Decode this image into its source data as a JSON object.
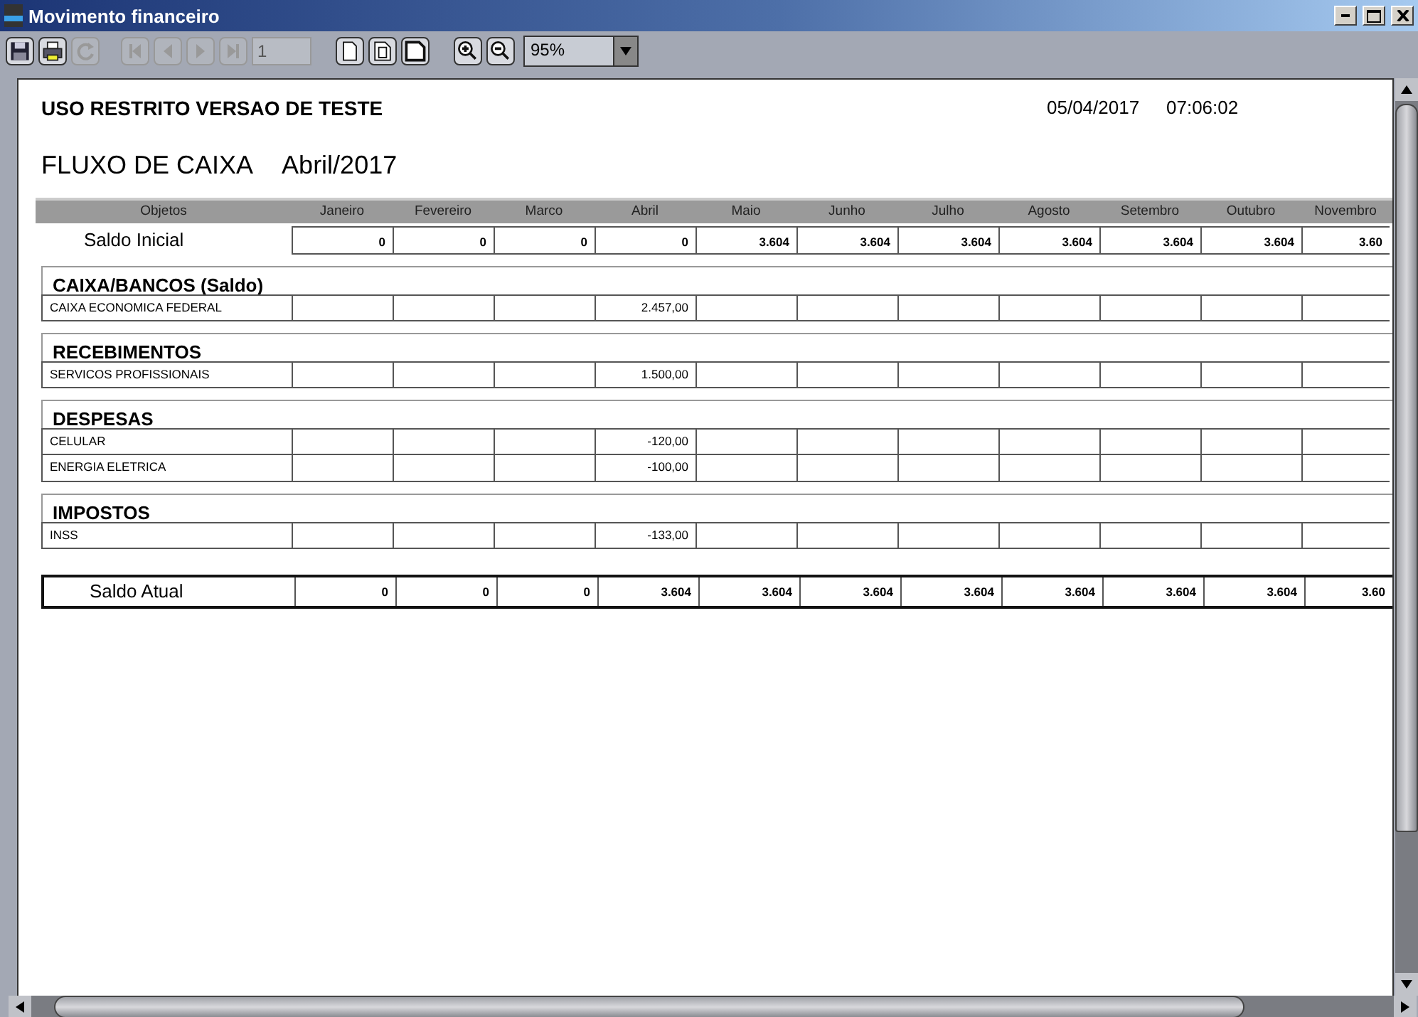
{
  "window": {
    "title": "Movimento financeiro"
  },
  "toolbar": {
    "buttons": [
      {
        "kind": "save",
        "disabled": false
      },
      {
        "kind": "print",
        "disabled": false
      },
      {
        "kind": "refresh",
        "disabled": true
      },
      {
        "kind": "first",
        "disabled": true
      },
      {
        "kind": "prev",
        "disabled": true
      },
      {
        "kind": "next",
        "disabled": true
      },
      {
        "kind": "last",
        "disabled": true
      },
      {
        "kind": "page",
        "disabled": false
      },
      {
        "kind": "page-width",
        "disabled": false
      },
      {
        "kind": "page-full",
        "disabled": false
      },
      {
        "kind": "zoom-in",
        "disabled": false
      },
      {
        "kind": "zoom-out",
        "disabled": false
      }
    ],
    "page_field": {
      "value": "1",
      "disabled": true
    },
    "zoom": "95%"
  },
  "report": {
    "notice": "USO RESTRITO VERSAO DE TESTE",
    "date": "05/04/2017",
    "time": "07:06:02",
    "title": "FLUXO DE CAIXA",
    "period": "Abril/2017",
    "columns": [
      "Objetos",
      "Janeiro",
      "Fevereiro",
      "Marco",
      "Abril",
      "Maio",
      "Junho",
      "Julho",
      "Agosto",
      "Setembro",
      "Outubro",
      "Novembro"
    ],
    "opening": {
      "label": "Saldo Inicial",
      "values": [
        "0",
        "0",
        "0",
        "0",
        "3.604",
        "3.604",
        "3.604",
        "3.604",
        "3.604",
        "3.604",
        "3.60"
      ]
    },
    "sections": [
      {
        "title": "CAIXA/BANCOS (Saldo)",
        "rows": [
          {
            "label": "CAIXA ECONOMICA FEDERAL",
            "abril": "2.457,00"
          }
        ]
      },
      {
        "title": "RECEBIMENTOS",
        "rows": [
          {
            "label": "SERVICOS PROFISSIONAIS",
            "abril": "1.500,00"
          }
        ]
      },
      {
        "title": "DESPESAS",
        "rows": [
          {
            "label": "CELULAR",
            "abril": "-120,00"
          },
          {
            "label": "ENERGIA ELETRICA",
            "abril": "-100,00"
          }
        ]
      },
      {
        "title": "IMPOSTOS",
        "rows": [
          {
            "label": "INSS",
            "abril": "-133,00"
          }
        ]
      }
    ],
    "closing": {
      "label": "Saldo Atual",
      "values": [
        "0",
        "0",
        "0",
        "3.604",
        "3.604",
        "3.604",
        "3.604",
        "3.604",
        "3.604",
        "3.604",
        "3.60"
      ]
    }
  }
}
